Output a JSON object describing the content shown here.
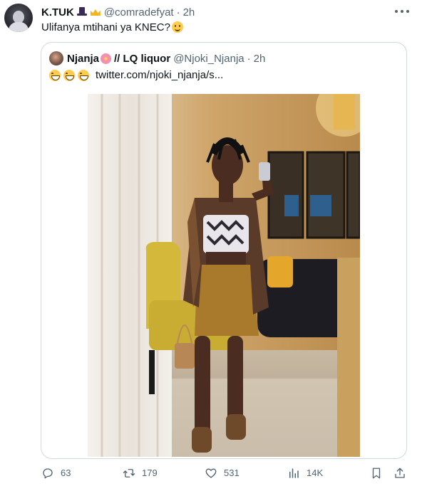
{
  "tweet": {
    "display_name": "K.TUK",
    "handle": "@comradefyat",
    "separator": "·",
    "time": "2h",
    "text": "Ulifanya mtihani ya KNEC?"
  },
  "quoted": {
    "display_name_part1": "Njanja",
    "display_name_part2": "// LQ liquor",
    "handle": "@Njoki_Njanja",
    "separator": "·",
    "time": "2h",
    "link": "twitter.com/njoki_njanja/s..."
  },
  "actions": {
    "replies": "63",
    "retweets": "179",
    "likes": "531",
    "views": "14K"
  },
  "icons": {
    "reply": "reply-icon",
    "retweet": "retweet-icon",
    "like": "heart-icon",
    "views": "analytics-icon",
    "bookmark": "bookmark-icon",
    "share": "share-icon",
    "more": "more-icon"
  },
  "colors": {
    "text": "#0f1419",
    "secondary": "#536471",
    "border": "#cfd9de"
  }
}
